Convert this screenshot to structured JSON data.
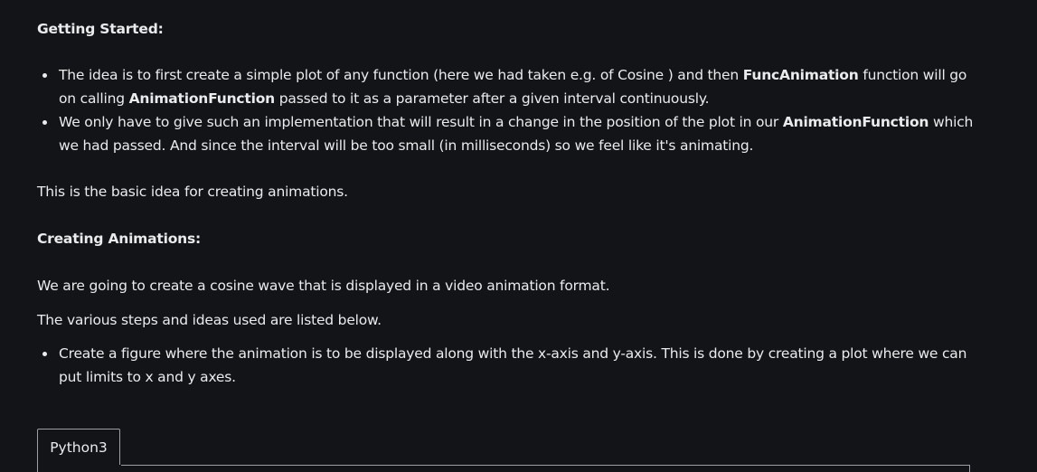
{
  "getting_started": {
    "heading": "Getting Started:",
    "bullets": [
      {
        "line1_a": "The idea is to first create a simple plot of any function (here we had taken e.g. of Cosine ) and then ",
        "line1_b": "FuncAnimation",
        "line1_c": " function will go",
        "line2_a": "on calling ",
        "line2_b": "AnimationFunction",
        "line2_c": " passed to it as a parameter after a given interval continuously."
      },
      {
        "line1_a": "We only have to give such an implementation that will result in a change in the position of the plot in our ",
        "line1_b": "AnimationFunction",
        "line1_c": " which",
        "line2_a": "we had passed. And since the interval will be too small (in milliseconds) so we feel like it's animating."
      }
    ]
  },
  "basic_idea": "This is the basic idea for creating animations.",
  "creating_animations": {
    "heading": "Creating Animations:",
    "para1": "We are going to create a cosine wave that is displayed in a video animation format.",
    "para2": "The various steps and ideas used are listed below.",
    "bullets": [
      {
        "line1": "Create a figure where the animation is to be displayed along with the x-axis and y-axis. This is done by creating a plot where we can",
        "line2": "put limits to x and y axes."
      }
    ]
  },
  "code_tabs": {
    "active": "Python3"
  }
}
